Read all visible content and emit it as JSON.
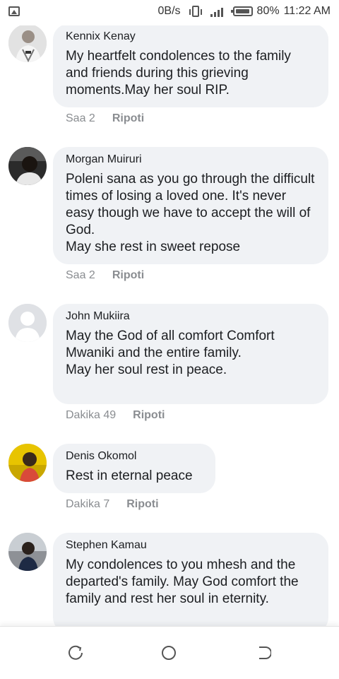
{
  "status_bar": {
    "speed": "0B/s",
    "battery": "80%",
    "time": "11:22 AM"
  },
  "comments": [
    {
      "author": "Kennix Kenay",
      "text": "My heartfelt condolences to the family and friends during this grieving moments.May her soul RIP.",
      "time": "Saa 2",
      "report": "Ripoti"
    },
    {
      "author": "Morgan Muiruri",
      "text": "Poleni sana as you go through the difficult times of losing a loved one. It's never easy though we have to accept the will of God.\nMay she rest in sweet repose",
      "time": "Saa 2",
      "report": "Ripoti"
    },
    {
      "author": "John Mukiira",
      "text": "May the God of all comfort Comfort Mwaniki and the entire family.\nMay her soul rest in peace.",
      "time": "Dakika 49",
      "report": "Ripoti"
    },
    {
      "author": "Denis Okomol",
      "text": "Rest in eternal peace",
      "time": "Dakika 7",
      "report": "Ripoti"
    },
    {
      "author": "Stephen Kamau",
      "text": "My condolences to you mhesh and the departed's family. May God comfort the family and rest her soul in eternity."
    }
  ],
  "icons": {
    "status_left": "image-icon",
    "vibrate": "vibrate-icon",
    "signal": "signal-icon",
    "battery": "battery-icon",
    "nav_recent": "recent-apps-icon",
    "nav_home": "home-icon",
    "nav_back": "back-icon"
  },
  "colors": {
    "bubble": "#f0f2f5",
    "meta_text": "#8a8d91"
  }
}
